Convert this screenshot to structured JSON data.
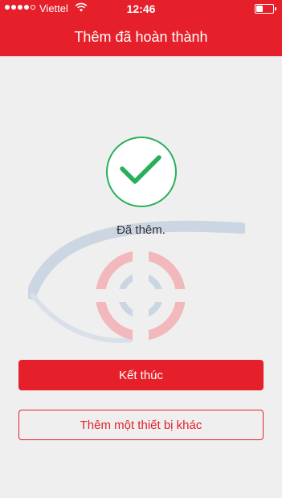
{
  "status_bar": {
    "carrier": "Viettel",
    "time": "12:46"
  },
  "header": {
    "title": "Thêm đã hoàn thành"
  },
  "main": {
    "status_text": "Đã thêm.",
    "finish_label": "Kết thúc",
    "add_another_label": "Thêm một thiết bị khác"
  },
  "colors": {
    "accent": "#e5202a",
    "success": "#27b05a"
  }
}
